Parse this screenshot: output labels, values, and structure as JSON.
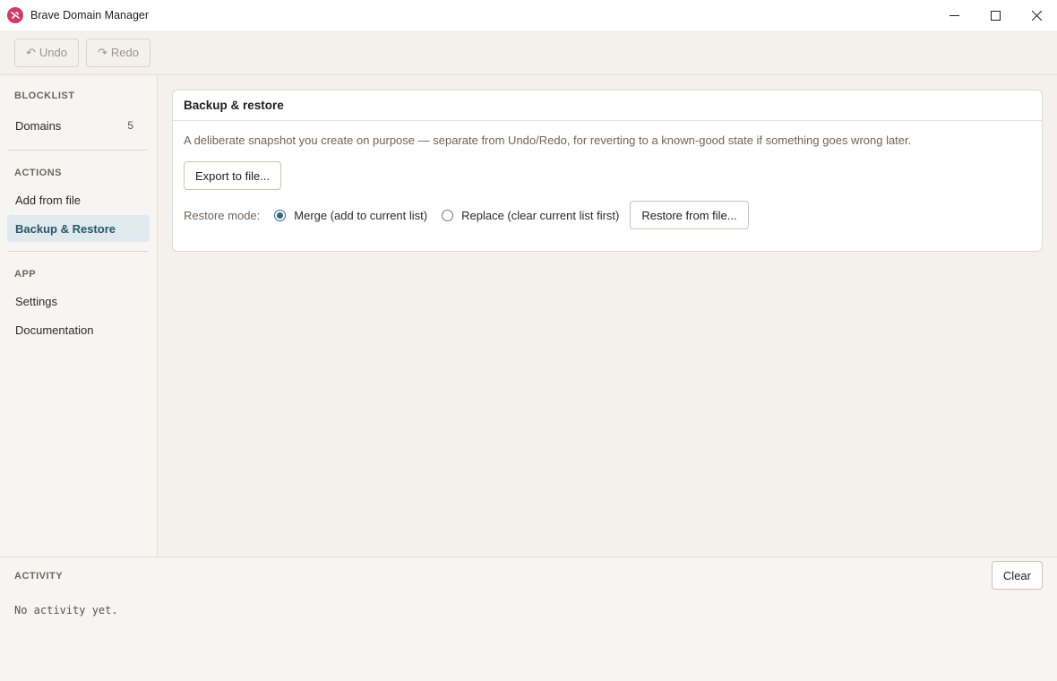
{
  "window": {
    "title": "Brave Domain Manager",
    "logo_icon": "brave-logo-icon",
    "accent": "#d63865"
  },
  "toolbar": {
    "undo_glyph": "↶",
    "undo_label": "Undo",
    "redo_glyph": "↷",
    "redo_label": "Redo"
  },
  "sidebar": {
    "sections": [
      {
        "label": "BLOCKLIST"
      },
      {
        "label": "ACTIONS"
      },
      {
        "label": "APP"
      }
    ],
    "items": [
      {
        "label": "Domains",
        "count": "5"
      },
      {
        "label": "Add from file"
      },
      {
        "label": "Backup & Restore",
        "active": true
      },
      {
        "label": "Settings"
      },
      {
        "label": "Documentation"
      }
    ],
    "active_color": "#dfe9ee"
  },
  "backup": {
    "title": "Backup & restore",
    "description": "A deliberate snapshot you create on purpose — separate from Undo/Redo, for reverting to a known-good state if something goes wrong later.",
    "export_label": "Export to file...",
    "restore_mode_label": "Restore mode:",
    "options": [
      {
        "label": "Merge (add to current list)",
        "selected": true
      },
      {
        "label": "Replace (clear current list first)",
        "selected": false
      }
    ],
    "restore_label": "Restore from file..."
  },
  "activity": {
    "title": "ACTIVITY",
    "clear_label": "Clear",
    "empty_text": "No activity yet."
  }
}
